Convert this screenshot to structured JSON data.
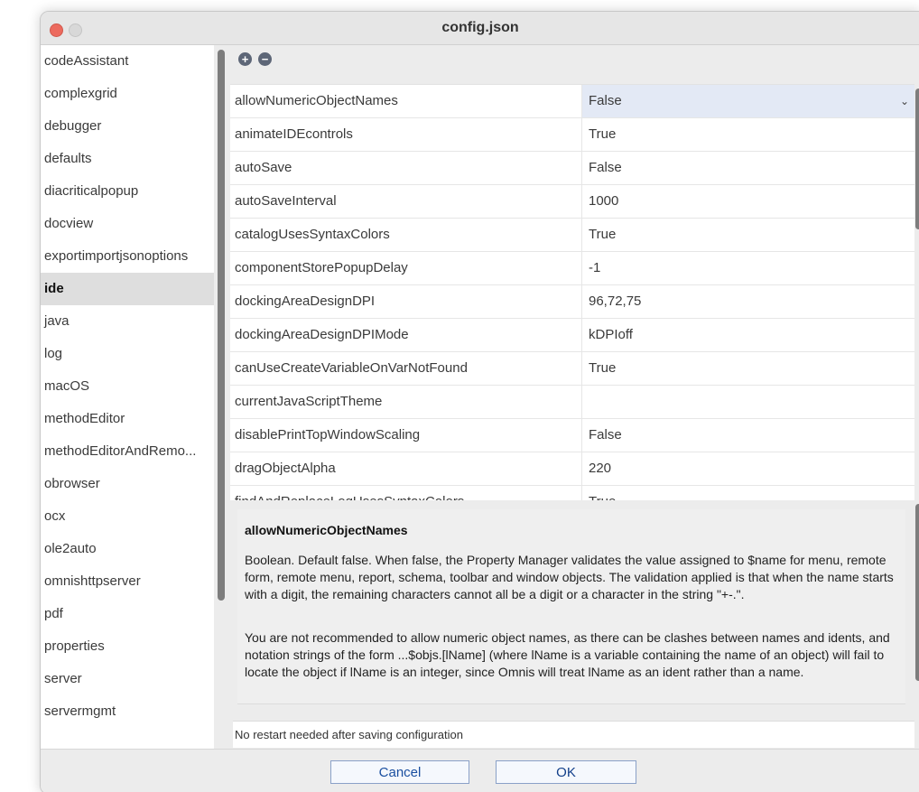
{
  "window": {
    "title": "config.json"
  },
  "sidebar": {
    "items": [
      {
        "label": "codeAssistant"
      },
      {
        "label": "complexgrid"
      },
      {
        "label": "debugger"
      },
      {
        "label": "defaults"
      },
      {
        "label": "diacriticalpopup"
      },
      {
        "label": "docview"
      },
      {
        "label": "exportimportjsonoptions"
      },
      {
        "label": "ide",
        "selected": true
      },
      {
        "label": "java"
      },
      {
        "label": "log"
      },
      {
        "label": "macOS"
      },
      {
        "label": "methodEditor"
      },
      {
        "label": "methodEditorAndRemo..."
      },
      {
        "label": "obrowser"
      },
      {
        "label": "ocx"
      },
      {
        "label": "ole2auto"
      },
      {
        "label": "omnishttpserver"
      },
      {
        "label": "pdf"
      },
      {
        "label": "properties"
      },
      {
        "label": "server"
      },
      {
        "label": "servermgmt"
      }
    ]
  },
  "toolbar": {
    "add_icon": "plus-circle-icon",
    "remove_icon": "minus-circle-icon"
  },
  "grid": {
    "rows": [
      {
        "name": "allowNumericObjectNames",
        "value": "False",
        "selected": true
      },
      {
        "name": "animateIDEcontrols",
        "value": "True"
      },
      {
        "name": "autoSave",
        "value": "False"
      },
      {
        "name": "autoSaveInterval",
        "value": "1000"
      },
      {
        "name": "catalogUsesSyntaxColors",
        "value": "True"
      },
      {
        "name": "componentStorePopupDelay",
        "value": "-1"
      },
      {
        "name": "dockingAreaDesignDPI",
        "value": "96,72,75"
      },
      {
        "name": "dockingAreaDesignDPIMode",
        "value": "kDPIoff"
      },
      {
        "name": "canUseCreateVariableOnVarNotFound",
        "value": "True"
      },
      {
        "name": "currentJavaScriptTheme",
        "value": ""
      },
      {
        "name": "disablePrintTopWindowScaling",
        "value": "False"
      },
      {
        "name": "dragObjectAlpha",
        "value": "220"
      },
      {
        "name": "findAndReplaceLogUsesSyntaxColors",
        "value": "True"
      }
    ]
  },
  "description": {
    "title": "allowNumericObjectNames",
    "paragraph1": "Boolean. Default false. When false, the Property Manager validates the value assigned to $name for menu, remote form, remote menu, report, schema, toolbar and window objects.  The validation applied is that when the name starts with a digit, the remaining characters cannot all be a digit or a character in the string \"+-.\".",
    "paragraph2": "You are not recommended to allow numeric object names, as there can be clashes between names and idents, and notation strings of the form ...$objs.[lName] (where lName is a variable containing the name of an object) will fail to locate the object if lName is an integer, since Omnis will treat lName as an ident rather than a name."
  },
  "status": {
    "text": "No restart needed after saving configuration"
  },
  "buttons": {
    "cancel": "Cancel",
    "ok": "OK"
  },
  "colors": {
    "close_button": "#ec6a5e",
    "selected_value_bg": "#e3e9f5",
    "button_text": "#1a4fa0"
  }
}
